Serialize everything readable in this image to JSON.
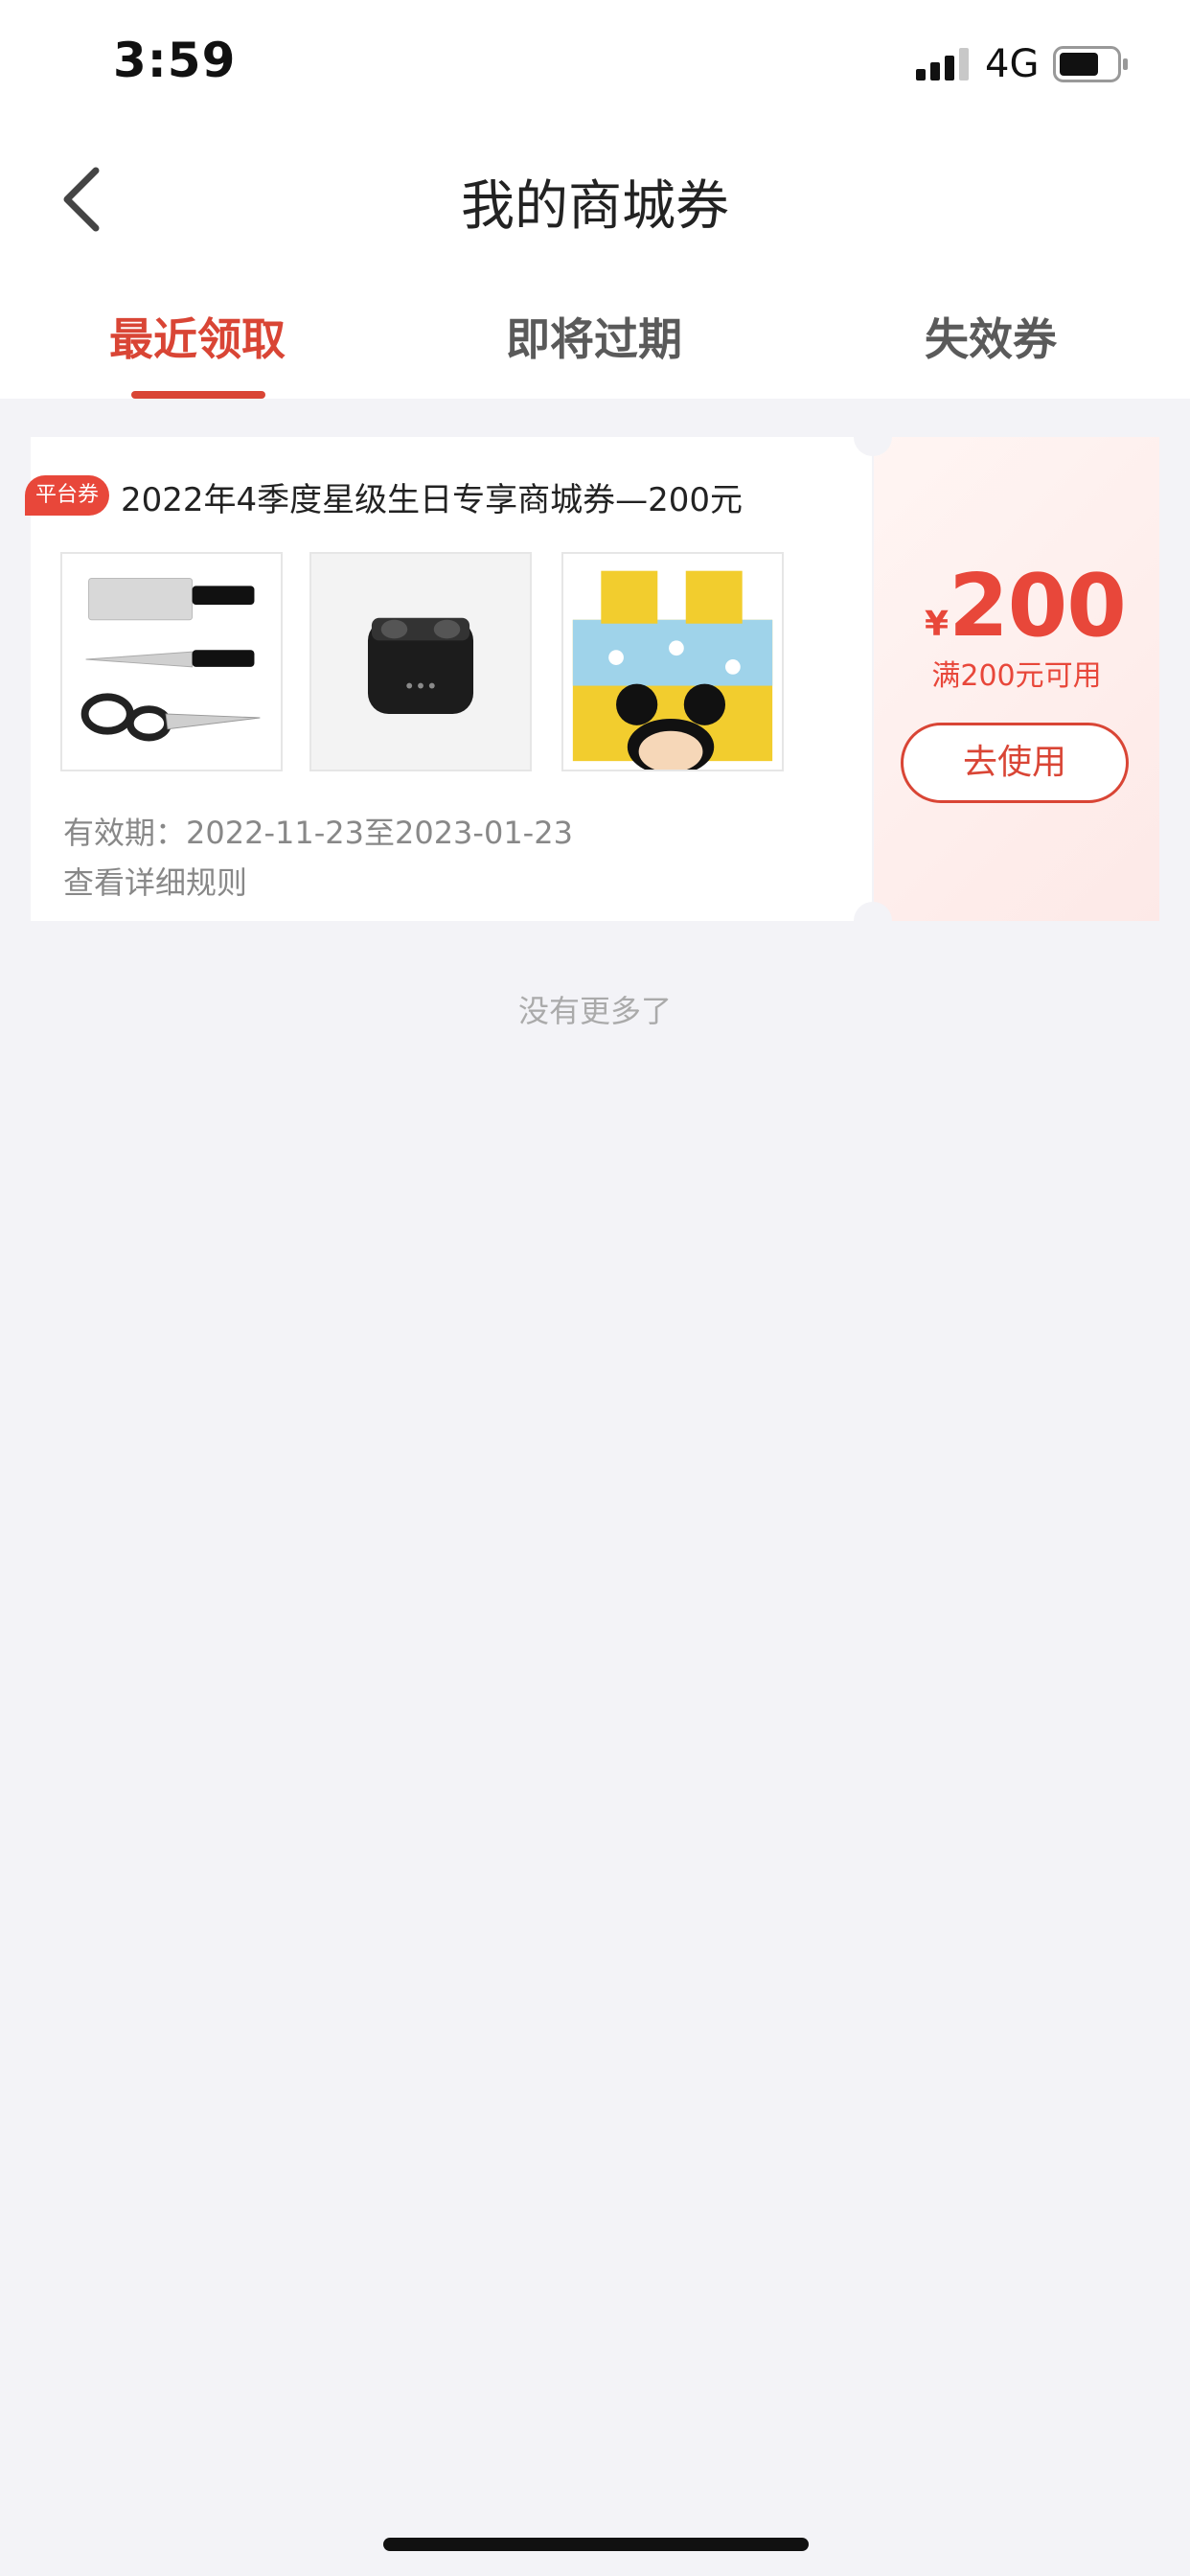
{
  "status_bar": {
    "time": "3:59",
    "network": "4G",
    "signal_icon": "signal-icon",
    "battery_icon": "battery-icon"
  },
  "nav": {
    "title": "我的商城券",
    "back_icon": "chevron-left-icon"
  },
  "tabs": [
    {
      "label": "最近领取",
      "active": true
    },
    {
      "label": "即将过期",
      "active": false
    },
    {
      "label": "失效券",
      "active": false
    }
  ],
  "coupon": {
    "badge": "平台券",
    "title": "2022年4季度星级生日专享商城券—200元",
    "products": [
      "kitchen-knife-set",
      "wireless-earbuds",
      "mickey-bedding-set"
    ],
    "validity": "有效期：2022-11-23至2023-01-23",
    "rules_link": "查看详细规则",
    "currency": "¥",
    "amount": "200",
    "condition": "满200元可用",
    "use_button": "去使用"
  },
  "footer": {
    "no_more": "没有更多了"
  },
  "colors": {
    "accent": "#d94535",
    "price": "#e8473a",
    "background": "#f3f3f7"
  }
}
